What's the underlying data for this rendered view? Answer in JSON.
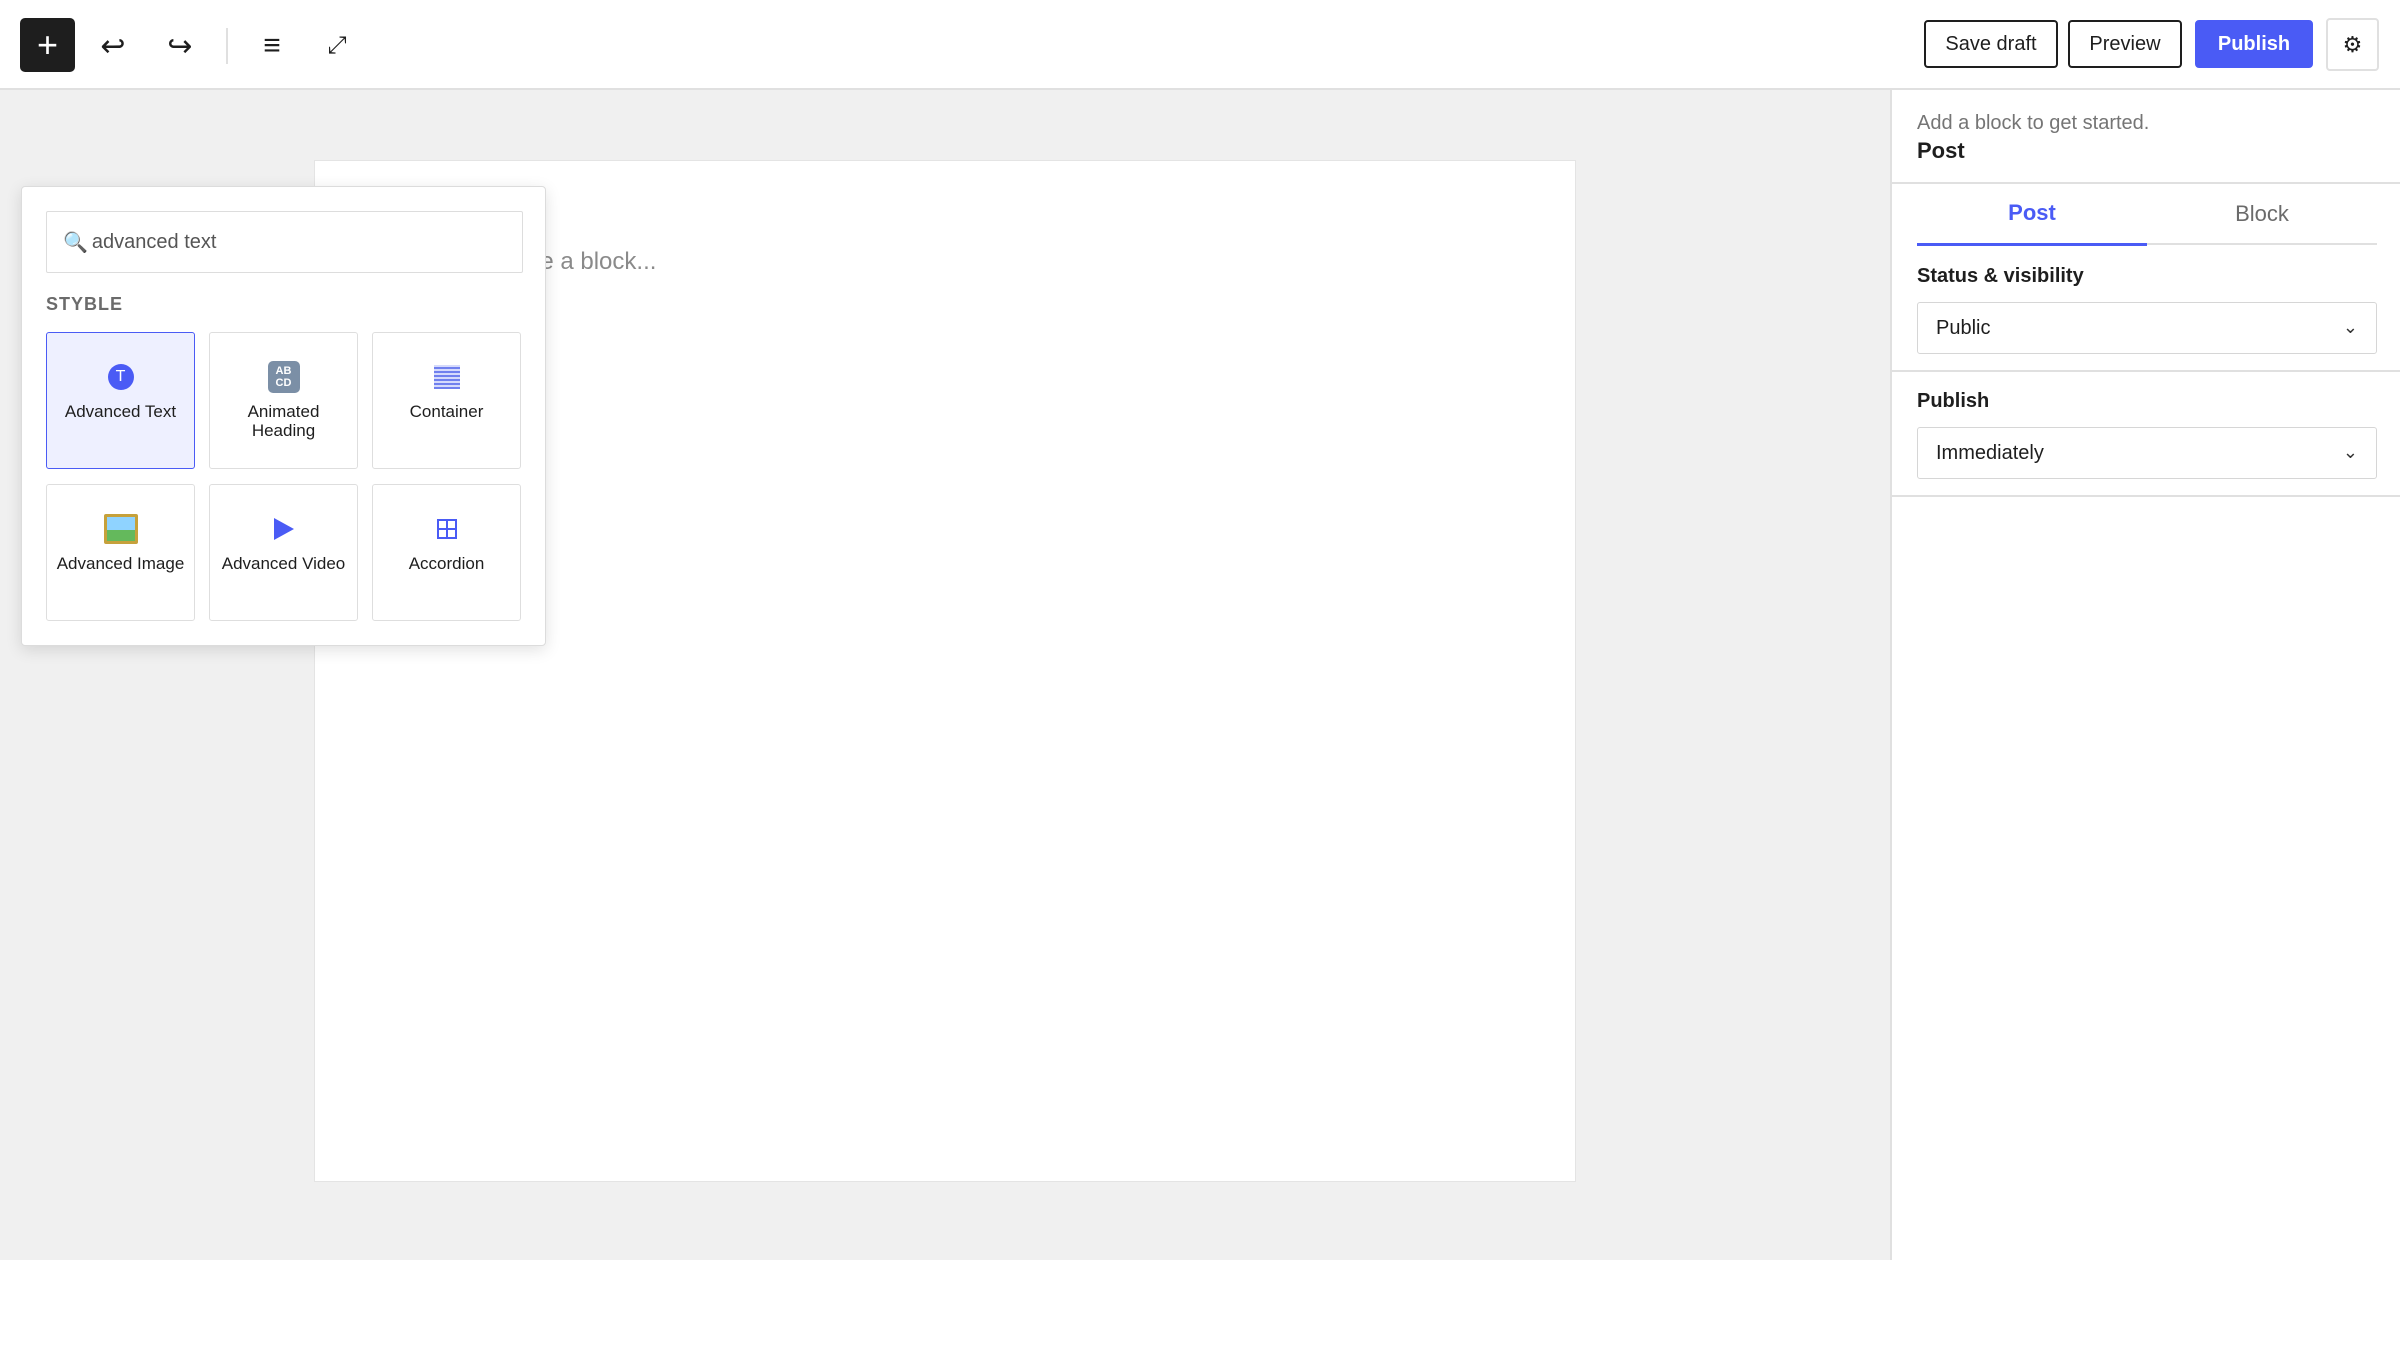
{
  "toolbar": {
    "add_icon": "plus-icon",
    "add_glyph": "+",
    "undo_glyph": "↩",
    "redo_glyph": "↪",
    "list_glyph": "≡",
    "expand_glyph": "⤢",
    "save_draft_label": "Save draft",
    "preview_label": "Preview",
    "publish_label": "Publish",
    "settings_glyph": "⚙"
  },
  "editor": {
    "placeholder": "ose a block..."
  },
  "inserter": {
    "search_icon": "🔍",
    "search_value": "advanced text",
    "category": "STYBLE",
    "blocks": [
      {
        "label": "Advanced Text",
        "icon": "circle-t-icon",
        "glyph": "T",
        "selected": true
      },
      {
        "label": "Animated Heading",
        "icon": "abcd-icon",
        "glyph": "AB CD",
        "selected": false
      },
      {
        "label": "Container",
        "icon": "container-icon",
        "selected": false
      },
      {
        "label": "Advanced Image",
        "icon": "image-icon",
        "selected": false
      },
      {
        "label": "Advanced Video",
        "icon": "play-icon",
        "selected": false
      },
      {
        "label": "Accordion",
        "icon": "grid-icon",
        "selected": false
      }
    ]
  },
  "sidebar": {
    "hint": "Add a block to get started.",
    "title": "Post",
    "tabs": [
      {
        "label": "Post",
        "active": true
      },
      {
        "label": "Block",
        "active": false
      }
    ],
    "status_label": "Status & visibility",
    "status_value": "Public",
    "publish_label": "Publish",
    "publish_value": "Immediately",
    "chevron": "⌄"
  },
  "colors": {
    "accent": "#4a5bf5",
    "canvas_bg": "#f0f0f0",
    "selected_block_bg": "#eef0ff"
  }
}
